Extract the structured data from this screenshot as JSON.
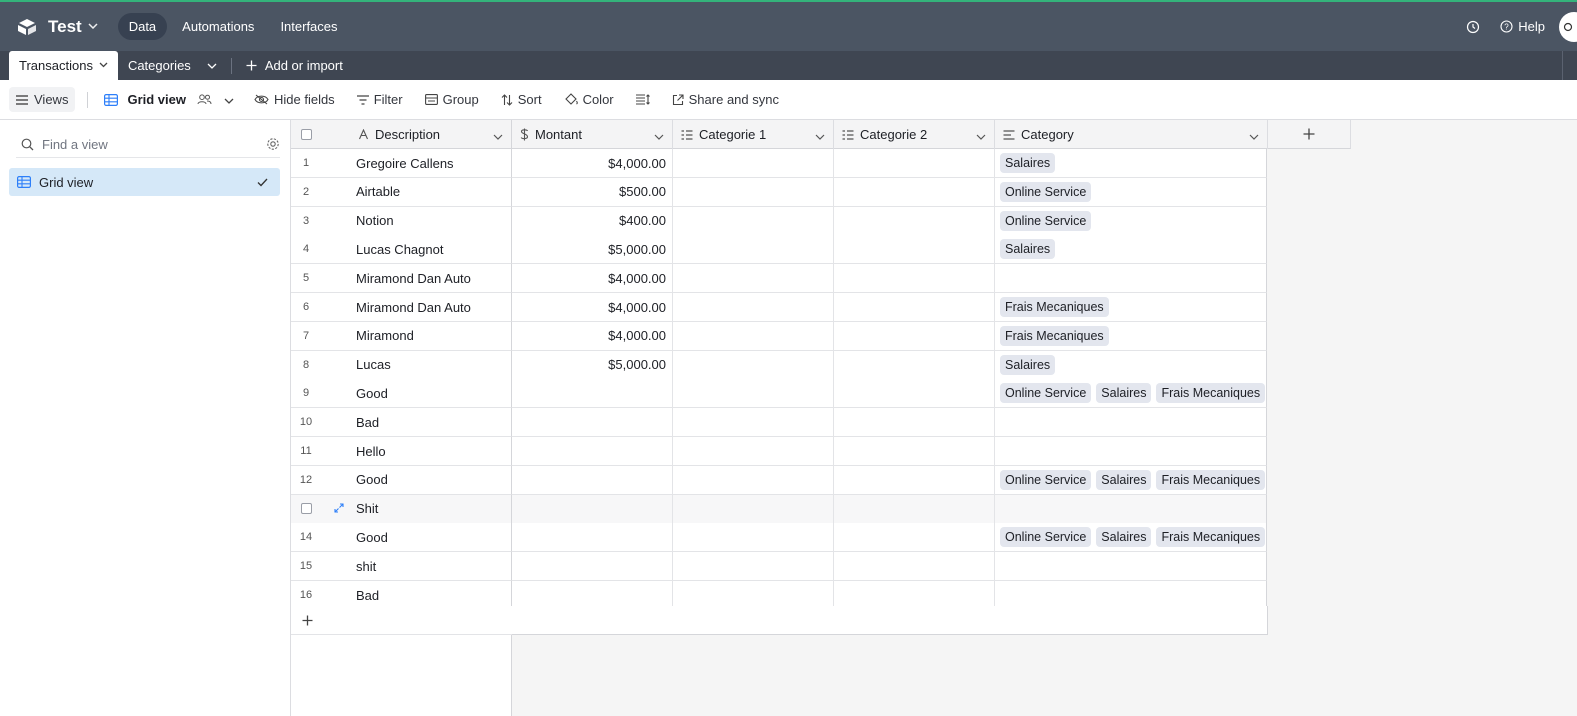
{
  "app": {
    "base_name": "Test",
    "nav": [
      "Data",
      "Automations",
      "Interfaces"
    ],
    "active_nav": "Data",
    "help_label": "Help"
  },
  "tables": {
    "tabs": [
      "Transactions",
      "Categories"
    ],
    "add_import_label": "Add or import"
  },
  "toolbar": {
    "views_label": "Views",
    "current_view": "Grid view",
    "hide_fields": "Hide fields",
    "filter": "Filter",
    "group": "Group",
    "sort": "Sort",
    "color": "Color",
    "share_sync": "Share and sync"
  },
  "sidebar": {
    "search_placeholder": "Find a view",
    "views": [
      "Grid view"
    ]
  },
  "grid": {
    "columns": [
      "Description",
      "Montant",
      "Categorie 1",
      "Categorie 2",
      "Category"
    ],
    "rows": [
      {
        "num": "1",
        "description": "Gregoire Callens",
        "montant": "$4,000.00",
        "categorie1": "",
        "categorie2": "",
        "category": [
          "Salaires"
        ]
      },
      {
        "num": "2",
        "description": "Airtable",
        "montant": "$500.00",
        "categorie1": "",
        "categorie2": "",
        "category": [
          "Online Service"
        ]
      },
      {
        "num": "3",
        "description": "Notion",
        "montant": "$400.00",
        "categorie1": "",
        "categorie2": "",
        "category": [
          "Online Service"
        ]
      },
      {
        "num": "4",
        "description": "Lucas Chagnot",
        "montant": "$5,000.00",
        "categorie1": "",
        "categorie2": "",
        "category": [
          "Salaires"
        ]
      },
      {
        "num": "5",
        "description": "Miramond Dan Auto",
        "montant": "$4,000.00",
        "categorie1": "",
        "categorie2": "",
        "category": []
      },
      {
        "num": "6",
        "description": "Miramond Dan Auto",
        "montant": "$4,000.00",
        "categorie1": "",
        "categorie2": "",
        "category": [
          "Frais Mecaniques"
        ]
      },
      {
        "num": "7",
        "description": "Miramond",
        "montant": "$4,000.00",
        "categorie1": "",
        "categorie2": "",
        "category": [
          "Frais Mecaniques"
        ]
      },
      {
        "num": "8",
        "description": "Lucas",
        "montant": "$5,000.00",
        "categorie1": "",
        "categorie2": "",
        "category": [
          "Salaires"
        ]
      },
      {
        "num": "9",
        "description": "Good",
        "montant": "",
        "categorie1": "",
        "categorie2": "",
        "category": [
          "Online Service",
          "Salaires",
          "Frais Mecaniques"
        ]
      },
      {
        "num": "10",
        "description": "Bad",
        "montant": "",
        "categorie1": "",
        "categorie2": "",
        "category": []
      },
      {
        "num": "11",
        "description": "Hello",
        "montant": "",
        "categorie1": "",
        "categorie2": "",
        "category": []
      },
      {
        "num": "12",
        "description": "Good",
        "montant": "",
        "categorie1": "",
        "categorie2": "",
        "category": [
          "Online Service",
          "Salaires",
          "Frais Mecaniques"
        ]
      },
      {
        "num": "",
        "description": "Shit",
        "montant": "",
        "categorie1": "",
        "categorie2": "",
        "category": [],
        "hovered": true
      },
      {
        "num": "14",
        "description": "Good",
        "montant": "",
        "categorie1": "",
        "categorie2": "",
        "category": [
          "Online Service",
          "Salaires",
          "Frais Mecaniques"
        ]
      },
      {
        "num": "15",
        "description": "shit",
        "montant": "",
        "categorie1": "",
        "categorie2": "",
        "category": []
      },
      {
        "num": "16",
        "description": "Bad",
        "montant": "",
        "categorie1": "",
        "categorie2": "",
        "category": []
      }
    ]
  }
}
